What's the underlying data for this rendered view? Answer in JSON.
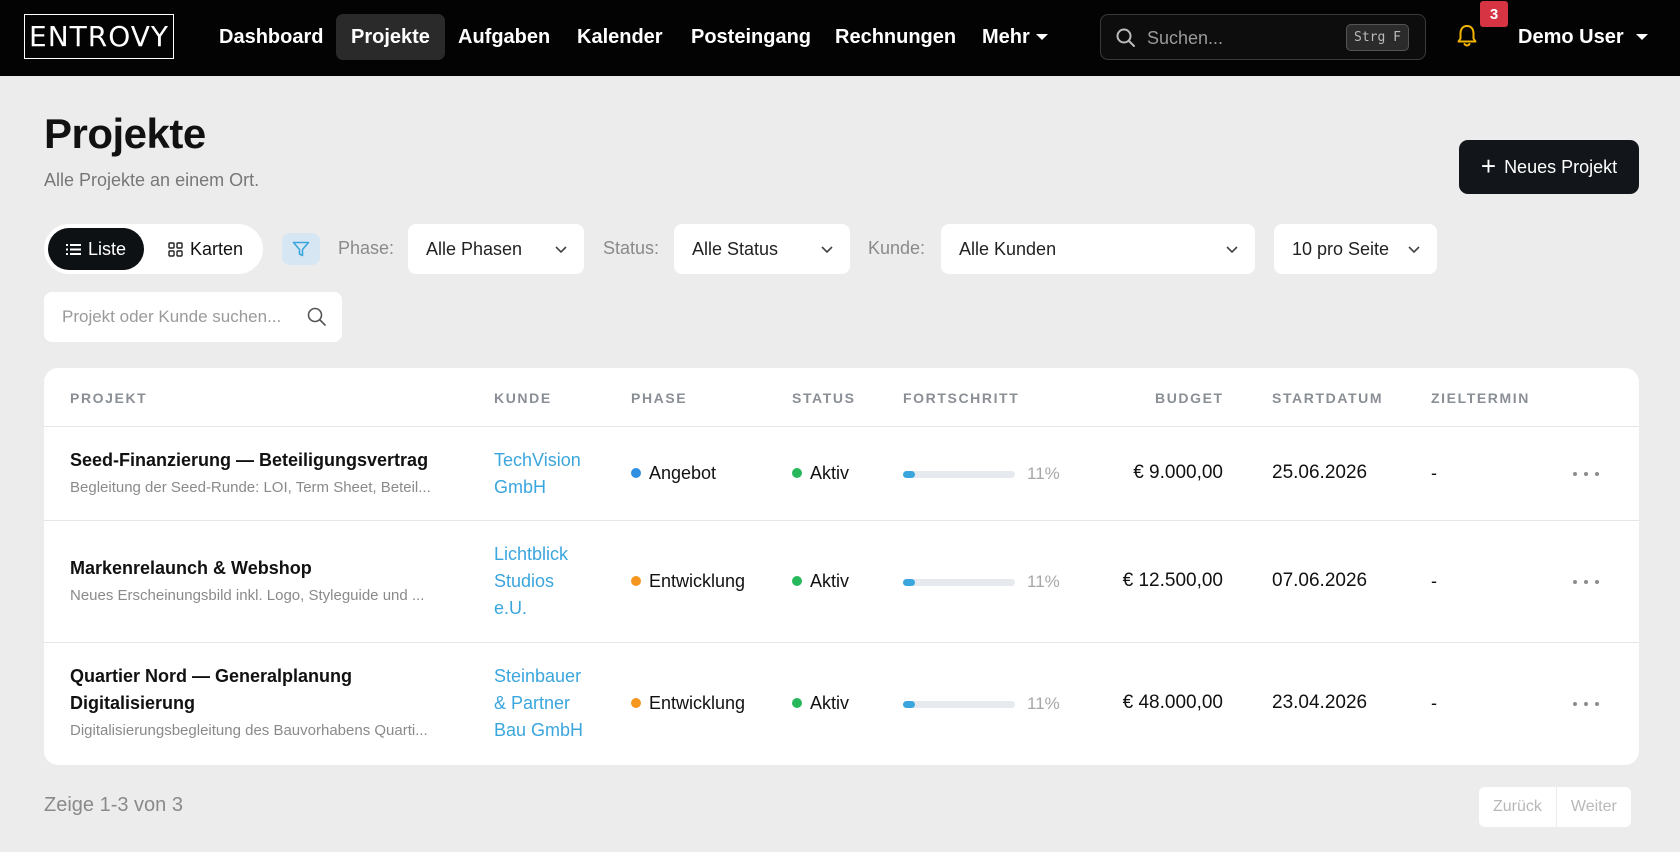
{
  "app": {
    "logo": "ENTROVY"
  },
  "nav": {
    "items": [
      "Dashboard",
      "Projekte",
      "Aufgaben",
      "Kalender",
      "Posteingang",
      "Rechnungen"
    ],
    "more": "Mehr",
    "active": "Projekte"
  },
  "search": {
    "placeholder": "Suchen...",
    "shortcut": "Strg F"
  },
  "notifications": {
    "count": "3"
  },
  "user": {
    "name": "Demo User"
  },
  "header": {
    "title": "Projekte",
    "subtitle": "Alle Projekte an einem Ort.",
    "new_button": "Neues Projekt"
  },
  "view": {
    "list": "Liste",
    "cards": "Karten",
    "active": "Liste"
  },
  "filters": {
    "phase_label": "Phase:",
    "phase_value": "Alle Phasen",
    "status_label": "Status:",
    "status_value": "Alle Status",
    "client_label": "Kunde:",
    "client_value": "Alle Kunden",
    "per_page": "10 pro Seite"
  },
  "project_search": {
    "placeholder": "Projekt oder Kunde suchen..."
  },
  "table": {
    "columns": [
      "PROJEKT",
      "KUNDE",
      "PHASE",
      "STATUS",
      "FORTSCHRITT",
      "BUDGET",
      "STARTDATUM",
      "ZIELTERMIN"
    ],
    "rows": [
      {
        "name": "Seed-Finanzierung — Beteiligungsvertrag",
        "description": "Begleitung der Seed-Runde: LOI, Term Sheet, Beteil...",
        "client": "TechVision GmbH",
        "phase": "Angebot",
        "phase_color": "#2f8fe0",
        "status": "Aktiv",
        "status_color": "#28b85c",
        "progress": 0.11,
        "progress_label": "11%",
        "budget": "€ 9.000,00",
        "start": "25.06.2026",
        "deadline": "-"
      },
      {
        "name": "Markenrelaunch & Webshop",
        "description": "Neues Erscheinungsbild inkl. Logo, Styleguide und ...",
        "client": "Lichtblick Studios e.U.",
        "phase": "Entwicklung",
        "phase_color": "#f5961f",
        "status": "Aktiv",
        "status_color": "#28b85c",
        "progress": 0.11,
        "progress_label": "11%",
        "budget": "€ 12.500,00",
        "start": "07.06.2026",
        "deadline": "-"
      },
      {
        "name": "Quartier Nord — Generalplanung Digitalisierung",
        "description": "Digitalisierungsbegleitung des Bauvorhabens Quarti...",
        "client": "Steinbauer & Partner Bau GmbH",
        "phase": "Entwicklung",
        "phase_color": "#f5961f",
        "status": "Aktiv",
        "status_color": "#28b85c",
        "progress": 0.11,
        "progress_label": "11%",
        "budget": "€ 48.000,00",
        "start": "23.04.2026",
        "deadline": "-"
      }
    ]
  },
  "pagination": {
    "summary": "Zeige 1-3 von 3",
    "prev": "Zurück",
    "next": "Weiter"
  }
}
